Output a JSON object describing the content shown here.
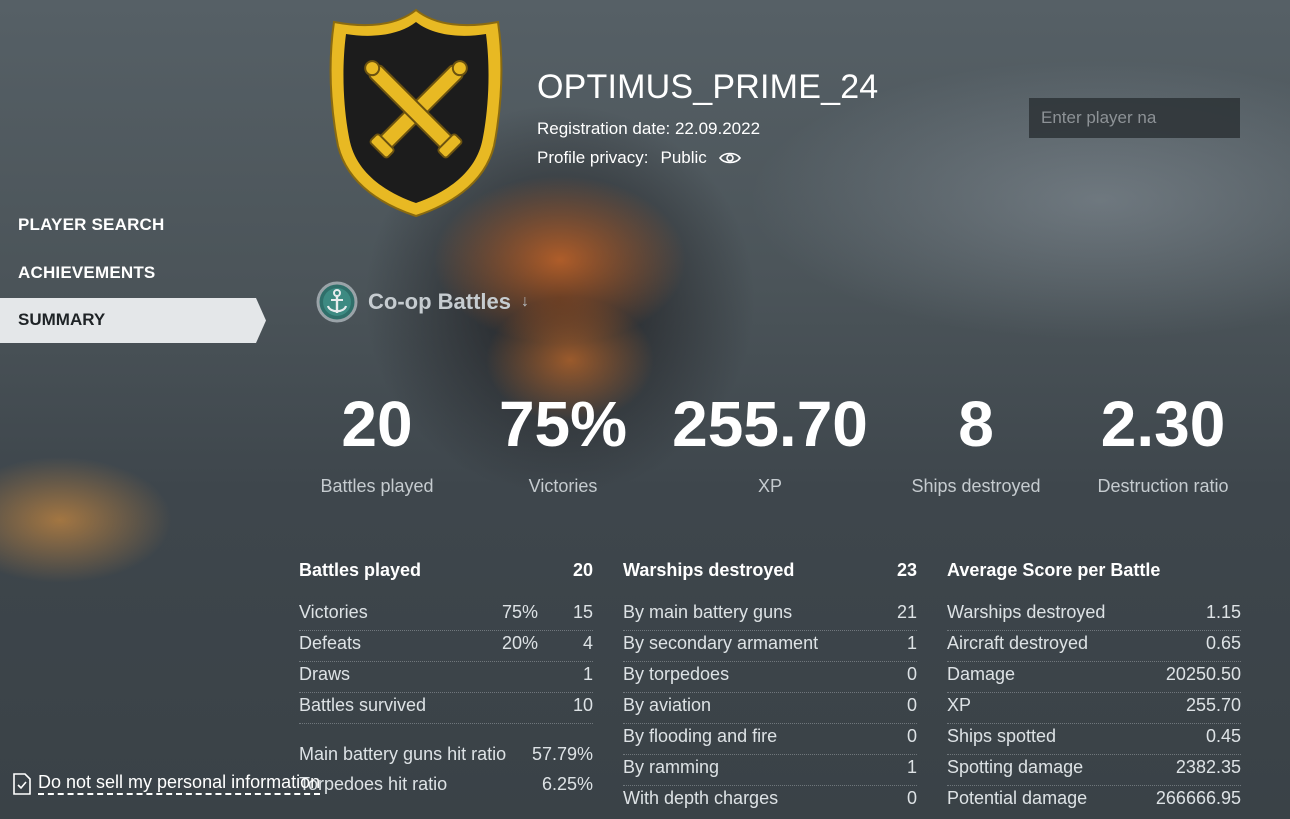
{
  "player": {
    "name": "OPTIMUS_PRIME_24",
    "registration": "Registration date: 22.09.2022",
    "privacy_label": "Profile privacy:",
    "privacy_value": "Public"
  },
  "search": {
    "placeholder": "Enter player na"
  },
  "nav": {
    "items": [
      {
        "label": "PLAYER SEARCH"
      },
      {
        "label": "ACHIEVEMENTS"
      },
      {
        "label": "SUMMARY"
      }
    ]
  },
  "mode": {
    "title": "Co-op Battles",
    "arrow": "↓"
  },
  "summary": [
    {
      "value": "20",
      "label": "Battles played"
    },
    {
      "value": "75%",
      "label": "Victories"
    },
    {
      "value": "255.70",
      "label": "XP"
    },
    {
      "value": "8",
      "label": "Ships destroyed"
    },
    {
      "value": "2.30",
      "label": "Destruction ratio"
    }
  ],
  "battles": {
    "header": {
      "label": "Battles played",
      "value": "20"
    },
    "rows": [
      {
        "label": "Victories",
        "pct": "75%",
        "value": "15"
      },
      {
        "label": "Defeats",
        "pct": "20%",
        "value": "4"
      },
      {
        "label": "Draws",
        "pct": "",
        "value": "1"
      },
      {
        "label": "Battles survived",
        "pct": "",
        "value": "10"
      }
    ],
    "hit": [
      {
        "label": "Main battery guns hit ratio",
        "value": "57.79%"
      },
      {
        "label": "Torpedoes hit ratio",
        "value": "6.25%"
      }
    ]
  },
  "warships": {
    "header": {
      "label": "Warships destroyed",
      "value": "23"
    },
    "rows": [
      {
        "label": "By main battery guns",
        "value": "21"
      },
      {
        "label": "By secondary armament",
        "value": "1"
      },
      {
        "label": "By torpedoes",
        "value": "0"
      },
      {
        "label": "By aviation",
        "value": "0"
      },
      {
        "label": "By flooding and fire",
        "value": "0"
      },
      {
        "label": "By ramming",
        "value": "1"
      },
      {
        "label": "With depth charges",
        "value": "0"
      }
    ]
  },
  "average": {
    "header": {
      "label": "Average Score per Battle"
    },
    "rows": [
      {
        "label": "Warships destroyed",
        "value": "1.15"
      },
      {
        "label": "Aircraft destroyed",
        "value": "0.65"
      },
      {
        "label": "Damage",
        "value": "20250.50"
      },
      {
        "label": "XP",
        "value": "255.70"
      },
      {
        "label": "Ships spotted",
        "value": "0.45"
      },
      {
        "label": "Spotting damage",
        "value": "2382.35"
      },
      {
        "label": "Potential damage",
        "value": "266666.95"
      }
    ]
  },
  "footer": {
    "link": "Do not sell my personal information"
  },
  "colors": {
    "emblem_gold": "#e8b923",
    "emblem_dark": "#1c1c1c",
    "active_nav": "#e4e7e9"
  }
}
